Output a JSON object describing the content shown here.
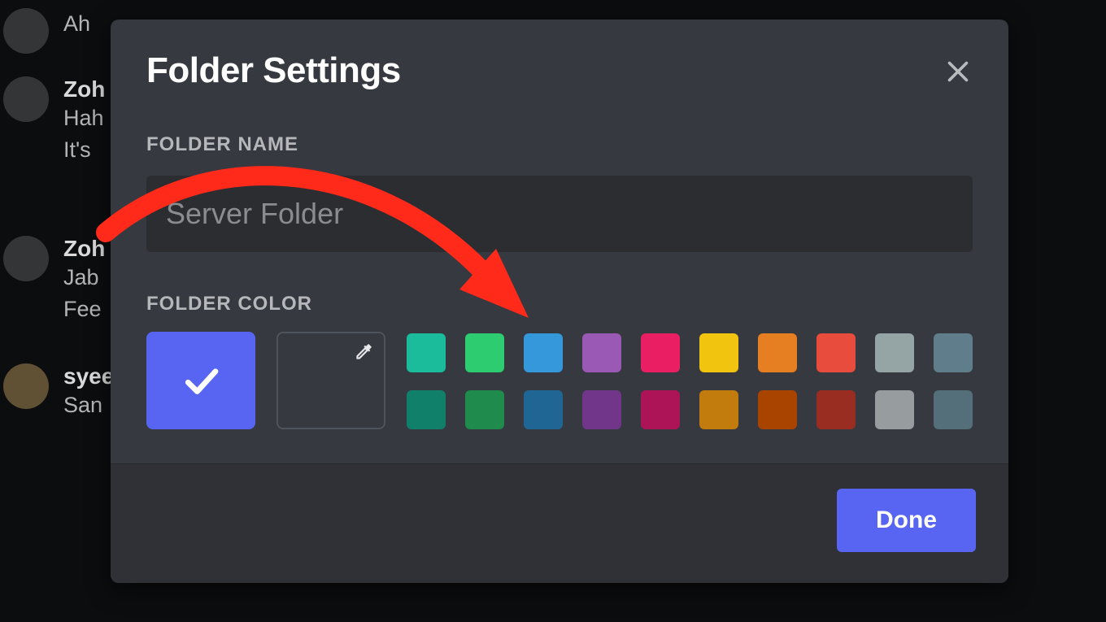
{
  "background_chat": {
    "rows": [
      {
        "name": "",
        "lines": [
          "Ah"
        ]
      },
      {
        "name": "Zoh",
        "lines": [
          "Hah",
          "It's"
        ]
      },
      {
        "name": "Zoh",
        "lines": [
          "Jab",
          "Fee"
        ]
      },
      {
        "name": "syee",
        "lines": [
          "San"
        ]
      }
    ]
  },
  "modal": {
    "title": "Folder Settings",
    "folder_name": {
      "label": "FOLDER NAME",
      "placeholder": "Server Folder",
      "value": ""
    },
    "folder_color": {
      "label": "FOLDER COLOR",
      "selected": "#5865f2",
      "swatches_row1": [
        "#1abc9c",
        "#2ecc71",
        "#3498db",
        "#9b59b6",
        "#e91e63",
        "#f1c40f",
        "#e67e22",
        "#e74c3c",
        "#95a5a6",
        "#607d8b"
      ],
      "swatches_row2": [
        "#11806a",
        "#1f8b4c",
        "#206694",
        "#71368a",
        "#ad1457",
        "#c27c0e",
        "#a84300",
        "#992d22",
        "#979c9f",
        "#546e7a"
      ]
    },
    "done_label": "Done"
  },
  "annotation": {
    "arrow_color": "#ff2a1a"
  }
}
